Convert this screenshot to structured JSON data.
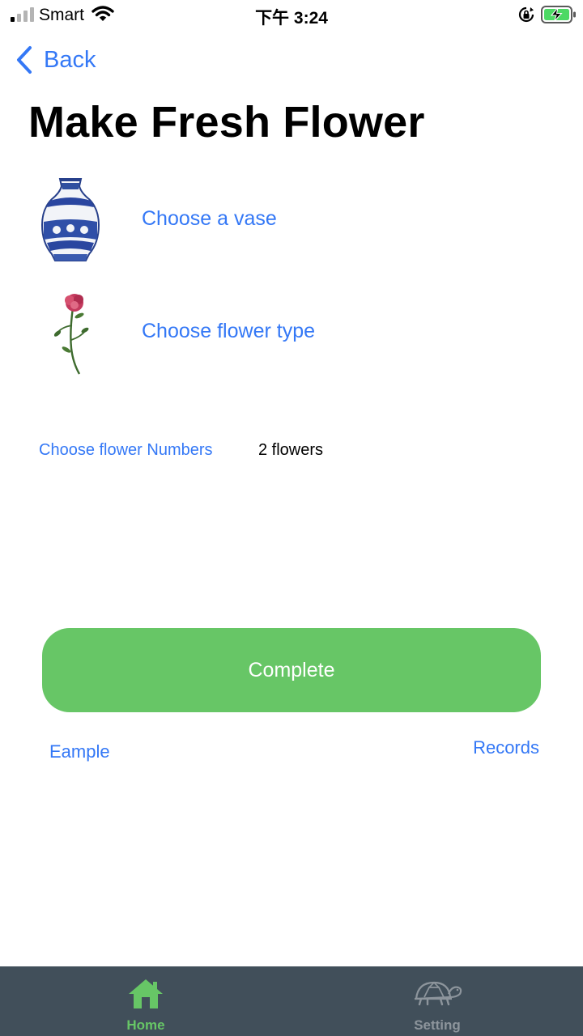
{
  "status_bar": {
    "carrier": "Smart",
    "time": "下午 3:24",
    "icons": [
      "signal-icon",
      "wifi-icon",
      "rotation-lock-icon",
      "battery-charging-icon"
    ]
  },
  "nav": {
    "back_label": "Back",
    "title": "Make Fresh Flower"
  },
  "options": {
    "vase_label": "Choose a vase",
    "flower_type_label": "Choose flower type",
    "numbers_label": "Choose flower Numbers",
    "numbers_value": "2 flowers"
  },
  "actions": {
    "complete_label": "Complete",
    "example_label": "Eample",
    "records_label": "Records"
  },
  "tabs": [
    {
      "label": "Home",
      "icon": "home-icon",
      "selected": true
    },
    {
      "label": "Setting",
      "icon": "turtle-icon",
      "selected": false
    }
  ],
  "colors": {
    "accent": "#3478f6",
    "button_green": "#67c666",
    "tab_bar": "#414f5a",
    "tab_inactive": "#8d959c"
  }
}
